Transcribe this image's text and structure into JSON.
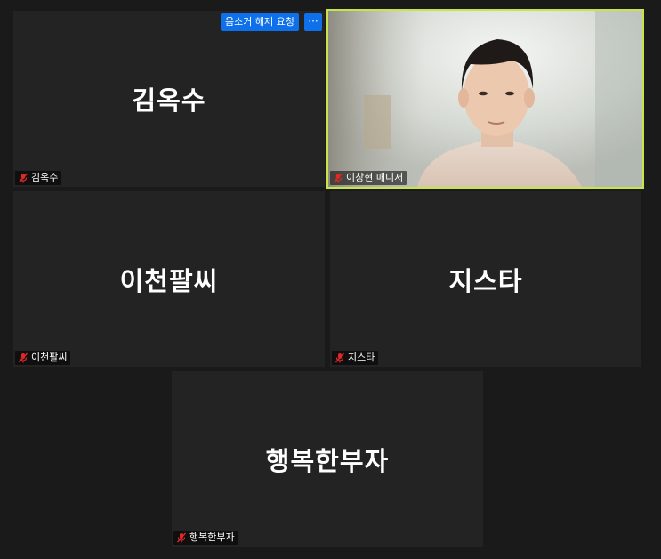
{
  "participants": [
    {
      "id": "p1",
      "display_name": "김옥수",
      "tag_name": "김옥수",
      "muted": true
    },
    {
      "id": "p2",
      "display_name": "",
      "tag_name": "이창현 매니저",
      "muted": true,
      "video_on": true,
      "active_speaker": true
    },
    {
      "id": "p3",
      "display_name": "이천팔씨",
      "tag_name": "이천팔씨",
      "muted": true
    },
    {
      "id": "p4",
      "display_name": "지스타",
      "tag_name": "지스타",
      "muted": true
    },
    {
      "id": "p5",
      "display_name": "행복한부자",
      "tag_name": "행복한부자",
      "muted": true
    }
  ],
  "hover_controls": {
    "unmute_request_label": "음소거 해제 요청",
    "more_label": "···"
  },
  "icons": {
    "muted_mic": "muted-mic-icon"
  },
  "colors": {
    "background": "#1a1a1a",
    "tile": "#232323",
    "active_border": "#c9e44a",
    "button_blue": "#0e71eb",
    "mute_red": "#e02828"
  }
}
